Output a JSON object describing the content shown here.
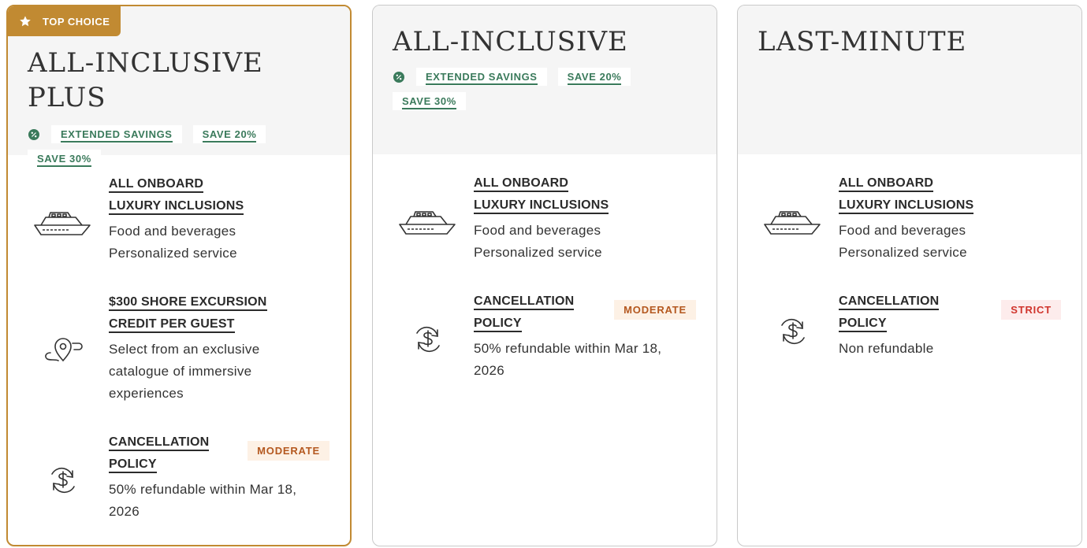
{
  "cards": [
    {
      "badge": "TOP CHOICE",
      "title_line1": "ALL-INCLUSIVE",
      "title_line2": "PLUS",
      "tags": [
        "EXTENDED SAVINGS",
        "SAVE 20%",
        "SAVE 30%"
      ],
      "inclusions": {
        "title_line1": "ALL ONBOARD",
        "title_line2": "LUXURY INCLUSIONS",
        "desc_line1": "Food and beverages",
        "desc_line2": "Personalized service"
      },
      "excursion": {
        "title_line1": "$300 SHORE EXCURSION",
        "title_line2": "CREDIT PER GUEST",
        "desc_line1": "Select from an exclusive",
        "desc_line2": "catalogue of immersive",
        "desc_line3": "experiences"
      },
      "cancellation": {
        "title_line1": "CANCELLATION",
        "title_line2": "POLICY",
        "level": "MODERATE",
        "desc_line1": "50% refundable within Mar 18,",
        "desc_line2": "2026"
      }
    },
    {
      "title_line1": "ALL-INCLUSIVE",
      "tags": [
        "EXTENDED SAVINGS",
        "SAVE 20%",
        "SAVE 30%"
      ],
      "inclusions": {
        "title_line1": "ALL ONBOARD",
        "title_line2": "LUXURY INCLUSIONS",
        "desc_line1": "Food and beverages",
        "desc_line2": "Personalized service"
      },
      "cancellation": {
        "title_line1": "CANCELLATION",
        "title_line2": "POLICY",
        "level": "MODERATE",
        "desc_line1": "50% refundable within Mar 18,",
        "desc_line2": "2026"
      }
    },
    {
      "title_line1": "LAST-MINUTE",
      "inclusions": {
        "title_line1": "ALL ONBOARD",
        "title_line2": "LUXURY INCLUSIONS",
        "desc_line1": "Food and beverages",
        "desc_line2": "Personalized service"
      },
      "cancellation": {
        "title_line1": "CANCELLATION",
        "title_line2": "POLICY",
        "level": "STRICT",
        "desc_line1": "Non refundable"
      }
    }
  ],
  "colors": {
    "top_choice_gold": "#c18a32",
    "savings_green": "#3a7a5b",
    "moderate_orange": "#b4581f",
    "strict_red": "#d0342c",
    "header_bg": "#f5f5f5"
  },
  "icons": {
    "badge": "star-icon",
    "tags": "percent-icon",
    "inclusions": "cruise-ship-icon",
    "excursion": "map-route-icon",
    "cancellation": "refund-dollar-icon"
  }
}
